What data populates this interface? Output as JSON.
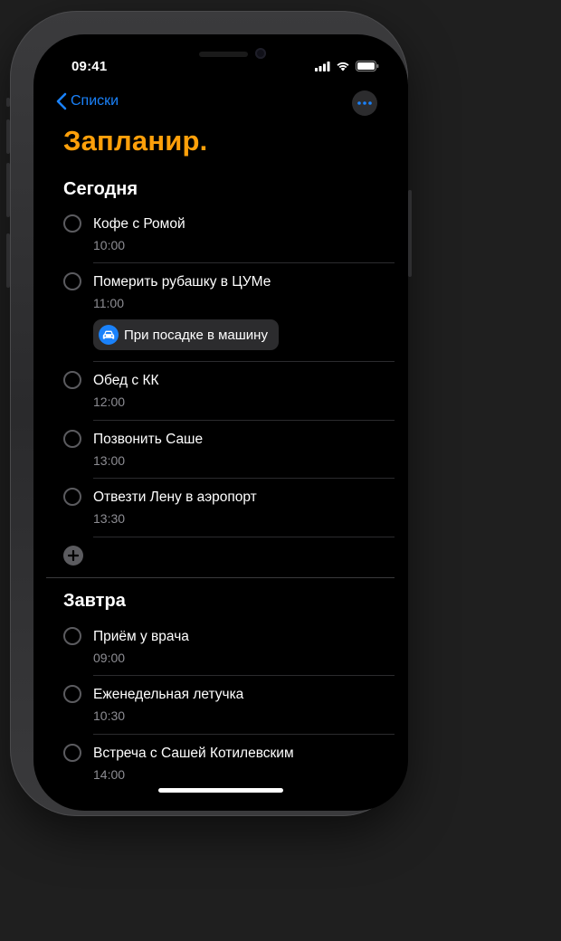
{
  "status_bar": {
    "time": "09:41"
  },
  "nav": {
    "back_label": "Списки"
  },
  "title": "Запланир.",
  "sections": [
    {
      "title": "Сегодня",
      "items": [
        {
          "title": "Кофе с Ромой",
          "time": "10:00"
        },
        {
          "title": "Померить рубашку в ЦУМе",
          "time": "11:00",
          "chip": "При посадке в машину"
        },
        {
          "title": "Обед с КК",
          "time": "12:00"
        },
        {
          "title": "Позвонить Саше",
          "time": "13:00"
        },
        {
          "title": "Отвезти Лену в аэропорт",
          "time": "13:30"
        }
      ]
    },
    {
      "title": "Завтра",
      "items": [
        {
          "title": "Приём у врача",
          "time": "09:00"
        },
        {
          "title": "Еженедельная летучка",
          "time": "10:30"
        },
        {
          "title": "Встреча с Сашей Котилевским",
          "time": "14:00"
        }
      ]
    }
  ],
  "colors": {
    "accent": "#ffa00a",
    "link": "#1a82fb",
    "background": "#000000",
    "secondary_text": "#8d8d93"
  }
}
